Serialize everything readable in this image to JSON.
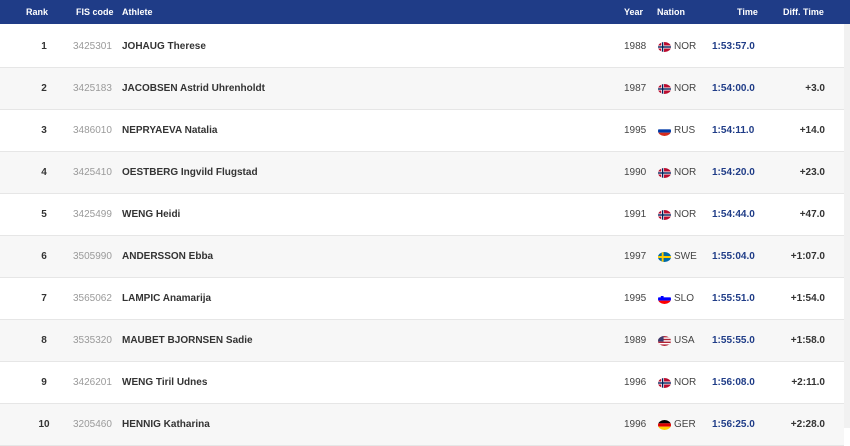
{
  "header": {
    "rank": "Rank",
    "fis_code": "FIS code",
    "athlete": "Athlete",
    "year": "Year",
    "nation": "Nation",
    "time": "Time",
    "diff": "Diff. Time"
  },
  "results": [
    {
      "rank": "1",
      "fis": "3425301",
      "athlete": "JOHAUG Therese",
      "year": "1988",
      "nation": "NOR",
      "time": "1:53:57.0",
      "diff": ""
    },
    {
      "rank": "2",
      "fis": "3425183",
      "athlete": "JACOBSEN Astrid Uhrenholdt",
      "year": "1987",
      "nation": "NOR",
      "time": "1:54:00.0",
      "diff": "+3.0"
    },
    {
      "rank": "3",
      "fis": "3486010",
      "athlete": "NEPRYAEVA Natalia",
      "year": "1995",
      "nation": "RUS",
      "time": "1:54:11.0",
      "diff": "+14.0"
    },
    {
      "rank": "4",
      "fis": "3425410",
      "athlete": "OESTBERG Ingvild Flugstad",
      "year": "1990",
      "nation": "NOR",
      "time": "1:54:20.0",
      "diff": "+23.0"
    },
    {
      "rank": "5",
      "fis": "3425499",
      "athlete": "WENG Heidi",
      "year": "1991",
      "nation": "NOR",
      "time": "1:54:44.0",
      "diff": "+47.0"
    },
    {
      "rank": "6",
      "fis": "3505990",
      "athlete": "ANDERSSON Ebba",
      "year": "1997",
      "nation": "SWE",
      "time": "1:55:04.0",
      "diff": "+1:07.0"
    },
    {
      "rank": "7",
      "fis": "3565062",
      "athlete": "LAMPIC Anamarija",
      "year": "1995",
      "nation": "SLO",
      "time": "1:55:51.0",
      "diff": "+1:54.0"
    },
    {
      "rank": "8",
      "fis": "3535320",
      "athlete": "MAUBET BJORNSEN Sadie",
      "year": "1989",
      "nation": "USA",
      "time": "1:55:55.0",
      "diff": "+1:58.0"
    },
    {
      "rank": "9",
      "fis": "3426201",
      "athlete": "WENG Tiril Udnes",
      "year": "1996",
      "nation": "NOR",
      "time": "1:56:08.0",
      "diff": "+2:11.0"
    },
    {
      "rank": "10",
      "fis": "3205460",
      "athlete": "HENNIG Katharina",
      "year": "1996",
      "nation": "GER",
      "time": "1:56:25.0",
      "diff": "+2:28.0"
    }
  ],
  "flag_icons": {
    "NOR": "norway-flag-icon",
    "RUS": "russia-flag-icon",
    "SWE": "sweden-flag-icon",
    "SLO": "slovenia-flag-icon",
    "USA": "usa-flag-icon",
    "GER": "germany-flag-icon"
  },
  "colors": {
    "header_bg": "#1f3c87",
    "time_text": "#1f3c87"
  }
}
